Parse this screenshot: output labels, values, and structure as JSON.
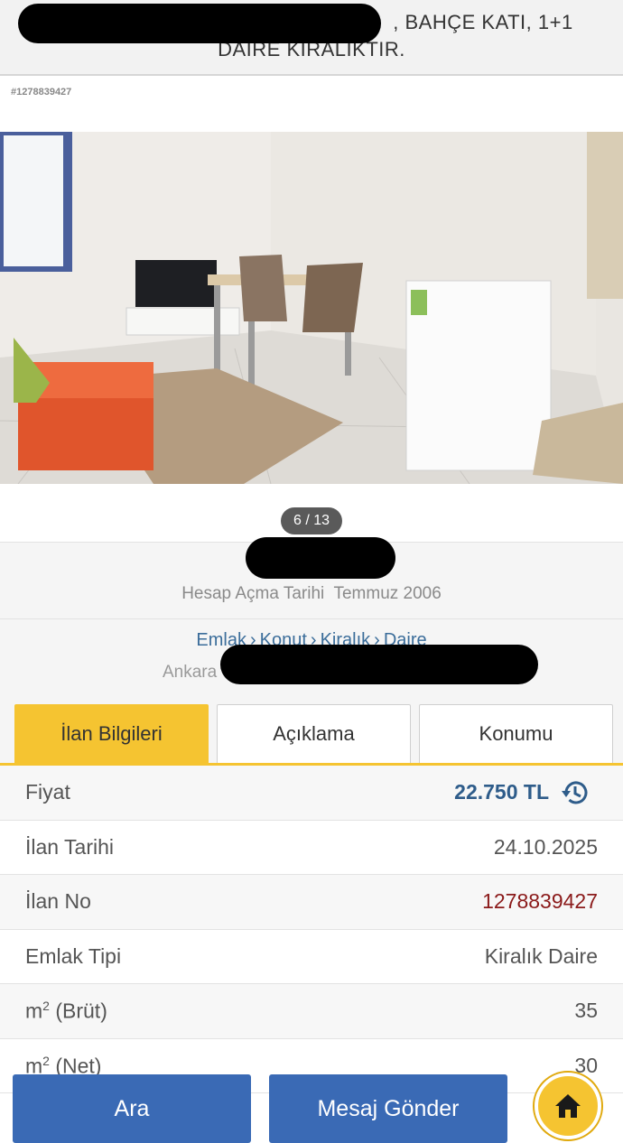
{
  "header": {
    "title_line1": ", BAHÇE KATI, 1+1",
    "title_line2": "DAİRE KİRALIKTIR."
  },
  "listing_id": "#1278839427",
  "gallery": {
    "counter": "6 / 13"
  },
  "seller": {
    "since_label": "Hesap Açma Tarihi",
    "since_value": "Temmuz 2006"
  },
  "breadcrumb": {
    "items": [
      "Emlak",
      "Konut",
      "Kiralık",
      "Daire"
    ],
    "location_prefix": "Ankara"
  },
  "tabs": [
    {
      "label": "İlan Bilgileri",
      "active": true
    },
    {
      "label": "Açıklama",
      "active": false
    },
    {
      "label": "Konumu",
      "active": false
    }
  ],
  "info": {
    "price_label": "Fiyat",
    "price_value": "22.750 TL",
    "date_label": "İlan Tarihi",
    "date_value": "24.10.2025",
    "no_label": "İlan No",
    "no_value": "1278839427",
    "type_label": "Emlak Tipi",
    "type_value": "Kiralık Daire",
    "gross_label": "(Brüt)",
    "gross_value": "35",
    "net_label": "(Net)",
    "net_value": "30"
  },
  "actions": {
    "call": "Ara",
    "message": "Mesaj Gönder"
  },
  "icons": {
    "history": "history-icon",
    "home": "home-icon"
  },
  "colors": {
    "accent": "#f5c431",
    "button": "#3a6ab5",
    "price": "#2e5c8a",
    "listing_no": "#8b1a1a"
  }
}
